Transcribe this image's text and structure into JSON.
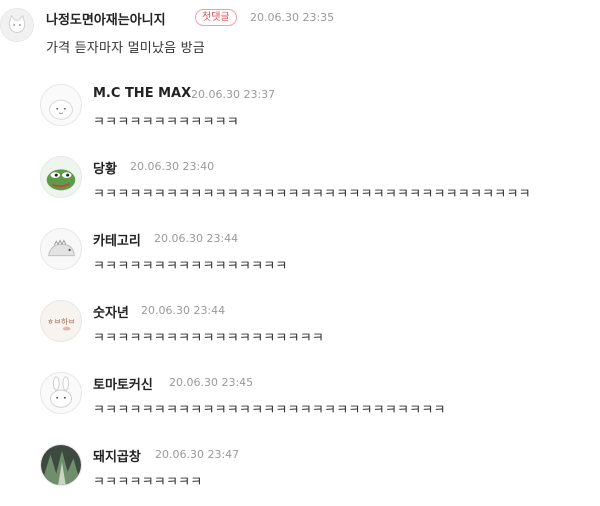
{
  "main_comment": {
    "nickname": "나정도면아재는아니지",
    "badge": "첫댓글",
    "time": "20.06.30 23:35",
    "text": "가격 듣자마자 멀미났음 방금"
  },
  "replies": [
    {
      "nickname": "M.C THE MAX",
      "time": "20.06.30 23:37",
      "text": "ㅋㅋㅋㅋㅋㅋㅋㅋㅋㅋㅋㅋ"
    },
    {
      "nickname": "당황",
      "time": "20.06.30 23:40",
      "text": "ㅋㅋㅋㅋㅋㅋㅋㅋㅋㅋㅋㅋㅋㅋㅋㅋㅋㅋㅋㅋㅋㅋㅋㅋㅋㅋㅋㅋㅋㅋㅋㅋㅋㅋㅋㅋ"
    },
    {
      "nickname": "카테고리",
      "time": "20.06.30 23:44",
      "text": "ㅋㅋㅋㅋㅋㅋㅋㅋㅋㅋㅋㅋㅋㅋㅋㅋ"
    },
    {
      "nickname": "숫자년",
      "time": "20.06.30 23:44",
      "text": "ㅋㅋㅋㅋㅋㅋㅋㅋㅋㅋㅋㅋㅋㅋㅋㅋㅋㅋㅋ",
      "avatar_text": "ㅎㅂ하ㅂ"
    },
    {
      "nickname": "토마토커신",
      "time": "20.06.30 23:45",
      "text": "ㅋㅋㅋㅋㅋㅋㅋㅋㅋㅋㅋㅋㅋㅋㅋㅋㅋㅋㅋㅋㅋㅋㅋㅋㅋㅋㅋㅋㅋ"
    },
    {
      "nickname": "돼지곱창",
      "time": "20.06.30 23:47",
      "text": "ㅋㅋㅋㅋㅋㅋㅋㅋㅋ"
    }
  ]
}
